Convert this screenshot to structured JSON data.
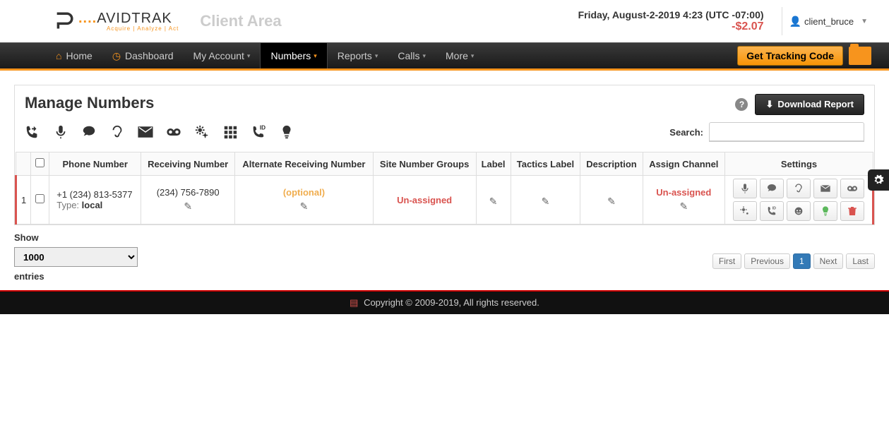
{
  "header": {
    "logo_brand": "AVIDTRAK",
    "logo_sub": "Acquire | Analyze | Act",
    "client_area": "Client Area",
    "datetime": "Friday, August-2-2019 4:23 (UTC -07:00)",
    "balance": "-$2.07",
    "username": "client_bruce"
  },
  "nav": {
    "home": "Home",
    "dashboard": "Dashboard",
    "my_account": "My Account",
    "numbers": "Numbers",
    "reports": "Reports",
    "calls": "Calls",
    "more": "More",
    "tracking_code": "Get Tracking Code"
  },
  "page": {
    "title": "Manage Numbers",
    "download_report": "Download Report",
    "search_label": "Search:"
  },
  "columns": {
    "row_num": "",
    "phone_number": "Phone Number",
    "receiving": "Receiving Number",
    "alt_receiving": "Alternate Receiving Number",
    "site_groups": "Site Number Groups",
    "label": "Label",
    "tactics": "Tactics Label",
    "description": "Description",
    "assign_channel": "Assign Channel",
    "settings": "Settings"
  },
  "rows": [
    {
      "idx": "1",
      "phone": "+1 (234) 813-5377",
      "type_label": "Type: ",
      "type_val": "local",
      "receiving": "(234) 756-7890",
      "alt_receiving": "(optional)",
      "site_groups": "Un-assigned",
      "label": "",
      "tactics": "",
      "description": "",
      "assign_channel": "Un-assigned"
    }
  ],
  "show": {
    "label_top": "Show",
    "selected": "1000",
    "label_bottom": "entries"
  },
  "pagination": {
    "first": "First",
    "prev": "Previous",
    "page": "1",
    "next": "Next",
    "last": "Last"
  },
  "footer": {
    "copyright": "Copyright © 2009-2019,",
    "rights": " All rights reserved."
  }
}
